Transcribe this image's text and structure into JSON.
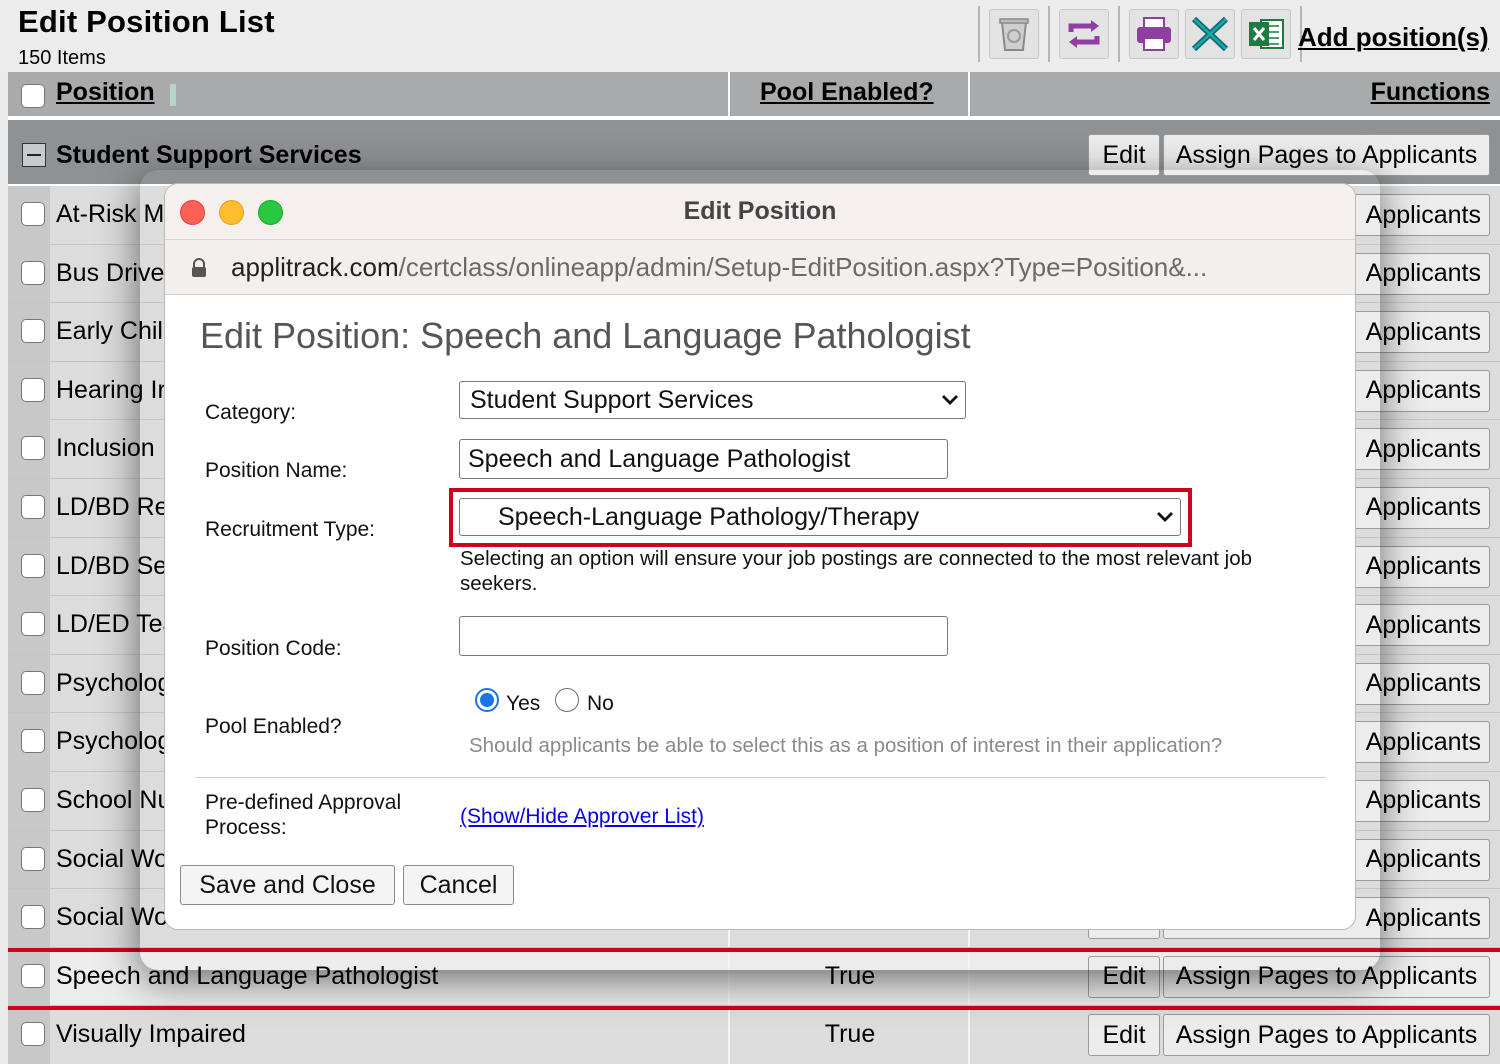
{
  "page": {
    "title": "Edit Position List",
    "item_count": "150 Items",
    "add_link": "Add position(s)"
  },
  "toolbar": {
    "icons": [
      "recycle-bin-icon",
      "refresh-icon",
      "print-icon",
      "excel-x-icon",
      "excel-export-icon"
    ]
  },
  "grid": {
    "headers": {
      "position": "Position",
      "pool": "Pool Enabled?",
      "functions": "Functions"
    },
    "category": "Student Support Services",
    "edit_label": "Edit",
    "assign_label": "Assign Pages to Applicants",
    "partial_assign": "Applicants",
    "rows": [
      {
        "name": "At-Risk Ma"
      },
      {
        "name": "Bus Drive"
      },
      {
        "name": "Early Chil"
      },
      {
        "name": "Hearing Ir"
      },
      {
        "name": "Inclusion"
      },
      {
        "name": "LD/BD Re"
      },
      {
        "name": "LD/BD Se"
      },
      {
        "name": "LD/ED Tea"
      },
      {
        "name": "Psycholog"
      },
      {
        "name": "Psycholog"
      },
      {
        "name": "School Nu"
      },
      {
        "name": "Social Wo"
      },
      {
        "name": "Social Wo"
      }
    ],
    "highlight_row": {
      "name": "Speech and Language Pathologist",
      "pool": "True"
    },
    "last_row": {
      "name": "Visually Impaired",
      "pool": "True"
    }
  },
  "modal": {
    "window_title": "Edit Position",
    "url_domain": "applitrack.com",
    "url_path": "/certclass/onlineapp/admin/Setup-EditPosition.aspx?Type=Position&...",
    "heading": "Edit Position: Speech and Language Pathologist",
    "category_label": "Category:",
    "category_value": "Student Support Services",
    "position_name_label": "Position Name:",
    "position_name_value": "Speech and Language Pathologist",
    "recruitment_label": "Recruitment Type:",
    "recruitment_value": "Speech-Language Pathology/Therapy",
    "recruitment_help": "Selecting an option will ensure your job postings are connected to the most relevant job seekers.",
    "position_code_label": "Position Code:",
    "position_code_value": "",
    "pool_label": "Pool Enabled?",
    "pool_yes": "Yes",
    "pool_no": "No",
    "pool_selected": "Yes",
    "pool_hint": "Should applicants be able to select this as a position of interest in their application?",
    "approval_label": "Pre-defined Approval Process:",
    "approval_link": "(Show/Hide Approver List)",
    "save_label": "Save and Close",
    "cancel_label": "Cancel"
  },
  "colors": {
    "highlight_red": "#d0021b",
    "radio_blue": "#1a73e8",
    "link_blue": "#0a00e8"
  }
}
